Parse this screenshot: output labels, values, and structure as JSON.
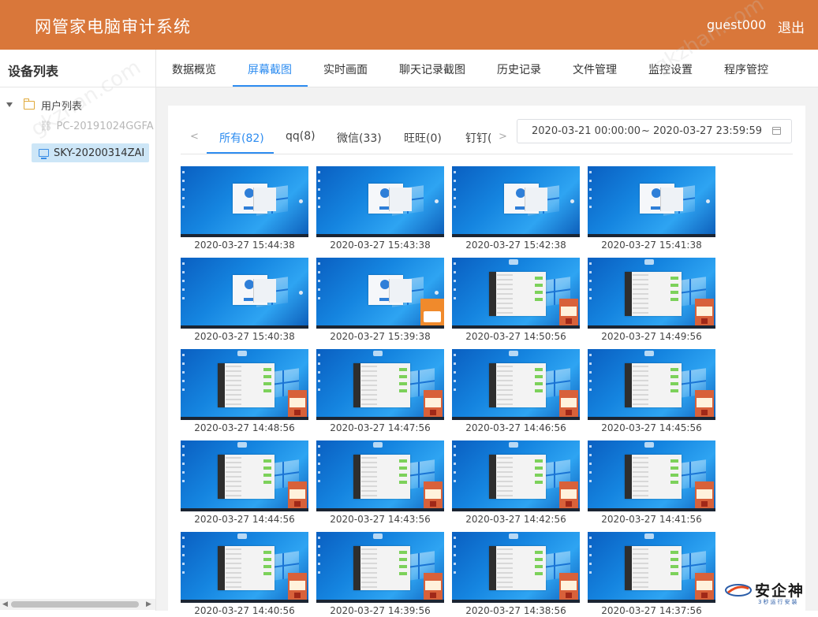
{
  "header": {
    "title": "网管家电脑审计系统",
    "user": "guest000",
    "logout": "退出",
    "bg_color": "#d9773a"
  },
  "watermark": {
    "site1": "gkzhan.com",
    "site2": "gkzhan.com"
  },
  "sidebar": {
    "title": "设备列表",
    "root_label": "用户列表",
    "items": [
      {
        "label": "PC-20191024GGFA",
        "status": "offline"
      },
      {
        "label": "SKY-20200314ZAI",
        "status": "selected"
      }
    ]
  },
  "nav": {
    "tabs": [
      {
        "label": "数据概览"
      },
      {
        "label": "屏幕截图",
        "active": true
      },
      {
        "label": "实时画面"
      },
      {
        "label": "聊天记录截图"
      },
      {
        "label": "历史记录"
      },
      {
        "label": "文件管理"
      },
      {
        "label": "监控设置"
      },
      {
        "label": "程序管控"
      }
    ],
    "accent": "#2d8cf0"
  },
  "subtabs": {
    "prev": "<",
    "next": ">",
    "items": [
      {
        "label": "所有(82)",
        "active": true
      },
      {
        "label": "qq(8)"
      },
      {
        "label": "微信(33)"
      },
      {
        "label": "旺旺(0)"
      },
      {
        "label": "钉钉("
      }
    ]
  },
  "date_range": {
    "start": "2020-03-21 00:00:00",
    "separator": "~",
    "end": "2020-03-27 23:59:59"
  },
  "screenshots": [
    {
      "time": "2020-03-27 15:44:38",
      "type": "dialog"
    },
    {
      "time": "2020-03-27 15:43:38",
      "type": "dialog"
    },
    {
      "time": "2020-03-27 15:42:38",
      "type": "dialog"
    },
    {
      "time": "2020-03-27 15:41:38",
      "type": "dialog"
    },
    {
      "time": "2020-03-27 15:40:38",
      "type": "dialog"
    },
    {
      "time": "2020-03-27 15:39:38",
      "type": "dialog-promo"
    },
    {
      "time": "2020-03-27 14:50:56",
      "type": "chat"
    },
    {
      "time": "2020-03-27 14:49:56",
      "type": "chat"
    },
    {
      "time": "2020-03-27 14:48:56",
      "type": "chat"
    },
    {
      "time": "2020-03-27 14:47:56",
      "type": "chat"
    },
    {
      "time": "2020-03-27 14:46:56",
      "type": "chat"
    },
    {
      "time": "2020-03-27 14:45:56",
      "type": "chat"
    },
    {
      "time": "2020-03-27 14:44:56",
      "type": "chat"
    },
    {
      "time": "2020-03-27 14:43:56",
      "type": "chat"
    },
    {
      "time": "2020-03-27 14:42:56",
      "type": "chat"
    },
    {
      "time": "2020-03-27 14:41:56",
      "type": "chat"
    },
    {
      "time": "2020-03-27 14:40:56",
      "type": "chat"
    },
    {
      "time": "2020-03-27 14:39:56",
      "type": "chat"
    },
    {
      "time": "2020-03-27 14:38:56",
      "type": "chat"
    },
    {
      "time": "2020-03-27 14:37:56",
      "type": "chat"
    }
  ],
  "brand": {
    "name": "安企神",
    "tagline": "3秒运行安装"
  }
}
